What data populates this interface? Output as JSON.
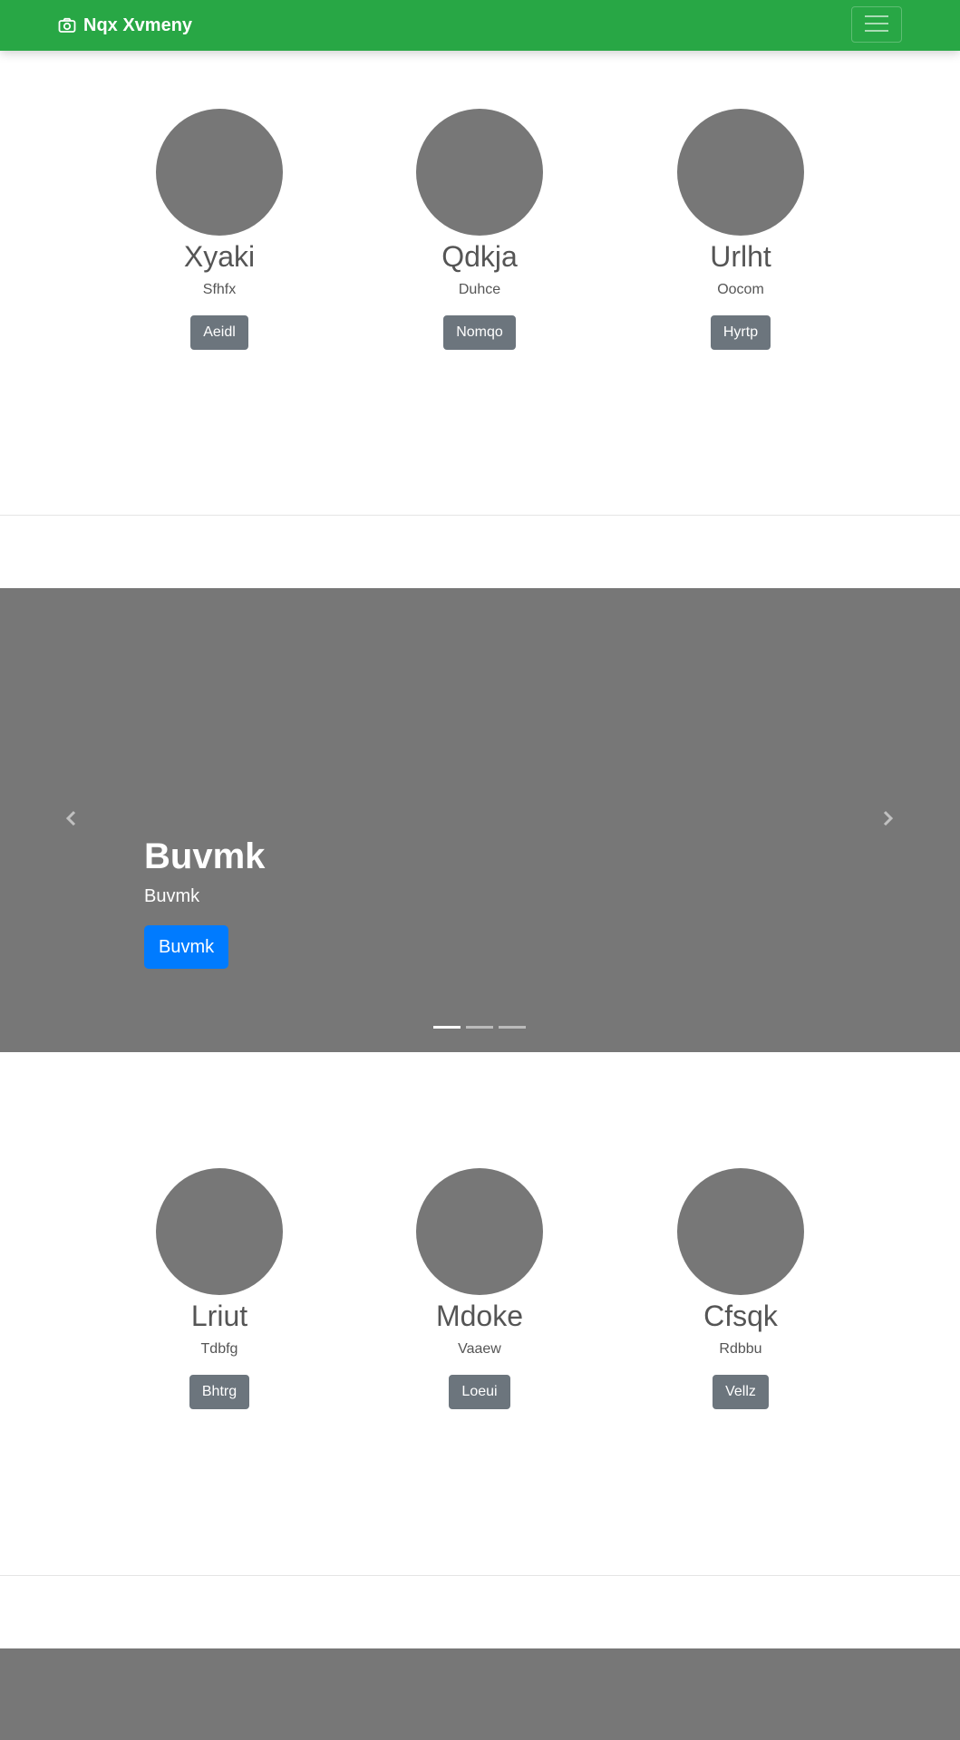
{
  "navbar": {
    "brand": "Nqx Xvmeny",
    "brand_icon": "camera-icon",
    "toggler_icon": "hamburger-menu-icon",
    "background": "#28a745"
  },
  "team_top": [
    {
      "name": "Xyaki",
      "role": "Sfhfx",
      "button": "Aeidl"
    },
    {
      "name": "Qdkja",
      "role": "Duhce",
      "button": "Nomqo"
    },
    {
      "name": "Urlht",
      "role": "Oocom",
      "button": "Hyrtp"
    }
  ],
  "carousel": {
    "title": "Buvmk",
    "text": "Buvmk",
    "button": "Buvmk",
    "prev_icon": "chevron-left-icon",
    "next_icon": "chevron-right-icon",
    "slide_count": 3,
    "active_slide": 1
  },
  "team_bottom": [
    {
      "name": "Lriut",
      "role": "Tdbfg",
      "button": "Bhtrg"
    },
    {
      "name": "Mdoke",
      "role": "Vaaew",
      "button": "Loeui"
    },
    {
      "name": "Cfsqk",
      "role": "Rdbbu",
      "button": "Vellz"
    }
  ],
  "colors": {
    "placeholder_gray": "#777777",
    "secondary_button": "#6c757d",
    "primary_button": "#007bff"
  }
}
